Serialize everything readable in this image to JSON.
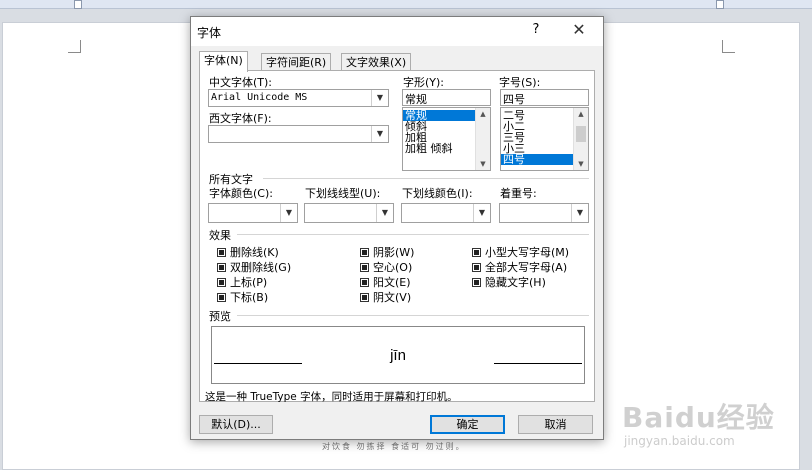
{
  "dialog": {
    "title": "字体",
    "help": "?",
    "close": "✕"
  },
  "tabs": [
    {
      "label": "字体(N)"
    },
    {
      "label": "字符间距(R)"
    },
    {
      "label": "文字效果(X)"
    }
  ],
  "font": {
    "chinese_label": "中文字体(T):",
    "chinese_value": "Arial Unicode MS",
    "western_label": "西文字体(F):",
    "western_value": "",
    "style_label": "字形(Y):",
    "style_value": "常规",
    "style_options": [
      "常规",
      "倾斜",
      "加粗",
      "加粗 倾斜"
    ],
    "size_label": "字号(S):",
    "size_value": "四号",
    "size_options": [
      "二号",
      "小二",
      "三号",
      "小三",
      "四号"
    ]
  },
  "all_text": {
    "section": "所有文字",
    "color_label": "字体颜色(C):",
    "underline_type_label": "下划线线型(U):",
    "underline_color_label": "下划线颜色(I):",
    "emphasis_label": "着重号:"
  },
  "effects": {
    "section": "效果",
    "col1": [
      "删除线(K)",
      "双删除线(G)",
      "上标(P)",
      "下标(B)"
    ],
    "col2": [
      "阴影(W)",
      "空心(O)",
      "阳文(E)",
      "阴文(V)"
    ],
    "col3": [
      "小型大写字母(M)",
      "全部大写字母(A)",
      "隐藏文字(H)"
    ]
  },
  "preview": {
    "label": "预览",
    "sample": "jīn",
    "description": "这是一种 TrueType 字体，同时适用于屏幕和打印机。"
  },
  "buttons": {
    "default": "默认(D)...",
    "ok": "确定",
    "cancel": "取消"
  },
  "document": {
    "footer": "对饮食 勿拣择 食适可 勿过则。"
  },
  "watermark": {
    "main": "Baidu经验",
    "sub": "jingyan.baidu.com"
  }
}
